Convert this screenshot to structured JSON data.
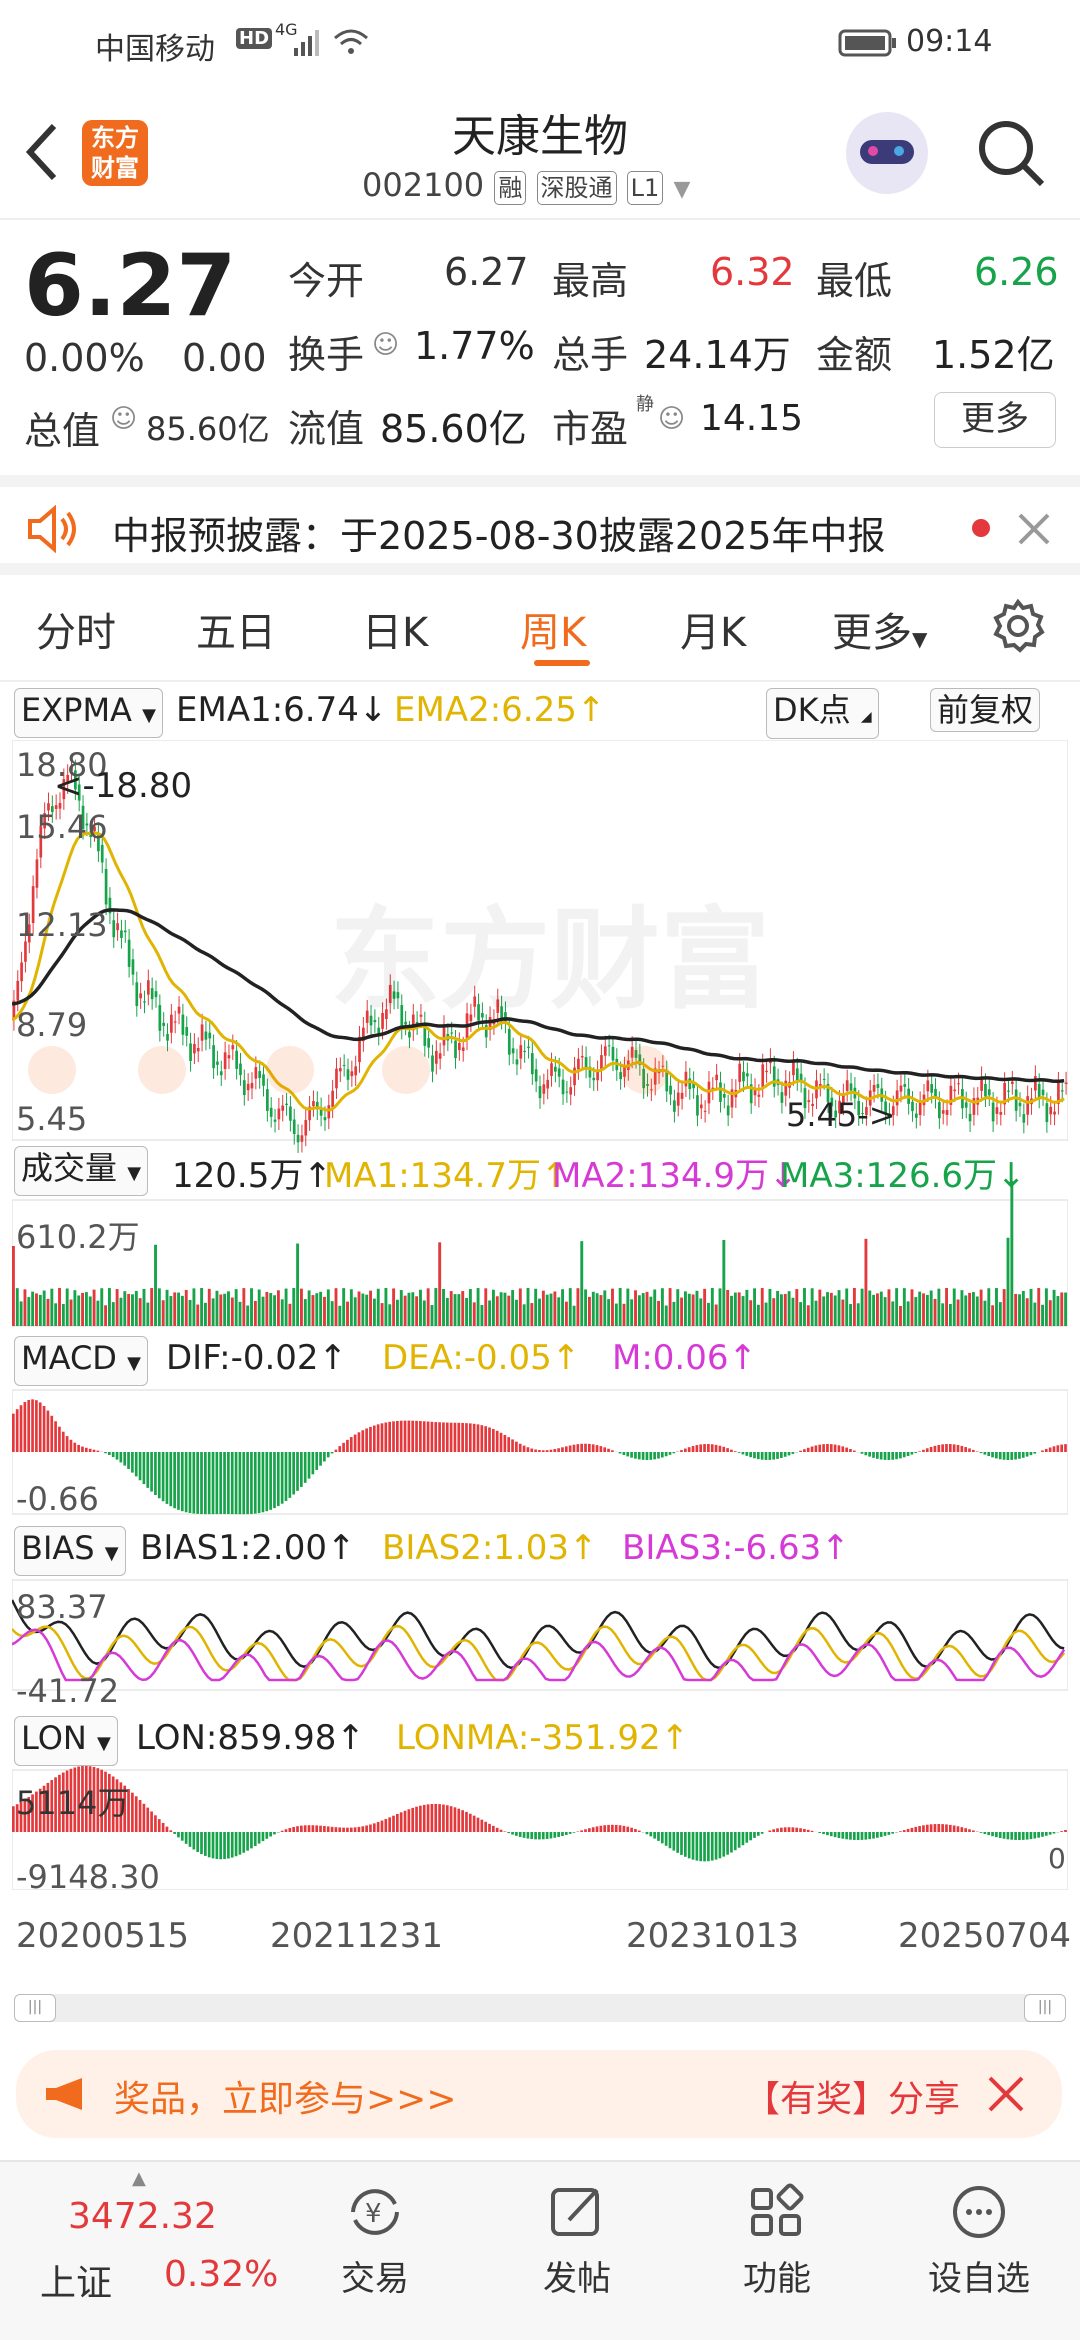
{
  "status_bar": {
    "carrier": "中国移动",
    "hd": "HD",
    "net": "4G",
    "time": "09:14"
  },
  "header": {
    "logo_line1": "东方",
    "logo_line2": "财富",
    "title": "天康生物",
    "code": "002100",
    "tag1": "融",
    "tag2": "深股通",
    "tag3": "L1"
  },
  "quote": {
    "price": "6.27",
    "change_pct": "0.00%",
    "change": "0.00",
    "open_label": "今开",
    "open": "6.27",
    "high_label": "最高",
    "high": "6.32",
    "low_label": "最低",
    "low": "6.26",
    "turnover_label": "换手",
    "turnover": "1.77%",
    "volume_label": "总手",
    "volume": "24.14万",
    "amount_label": "金额",
    "amount": "1.52亿",
    "mktcap_label": "总值",
    "mktcap": "85.60亿",
    "float_label": "流值",
    "float": "85.60亿",
    "pe_label": "市盈",
    "pe_sup": "静",
    "pe": "14.15",
    "more_label": "更多"
  },
  "notice": {
    "text": "中报预披露：于2025-08-30披露2025年中报"
  },
  "tabs": [
    "分时",
    "五日",
    "日K",
    "周K",
    "月K",
    "更多"
  ],
  "active_tab": "周K",
  "kline": {
    "indicator": "EXPMA",
    "ema1": "EMA1:6.74",
    "ema2": "EMA2:6.25",
    "dk_label": "DK点",
    "fq_label": "前复权",
    "y_labels": [
      "18.80",
      "15.46",
      "12.13",
      "8.79",
      "5.45"
    ],
    "max_marker": "<-18.80",
    "min_marker": "5.45->",
    "watermark": "东方财富"
  },
  "volume": {
    "label": "成交量",
    "value": "120.5万",
    "ma1": "MA1:134.7万",
    "ma2": "MA2:134.9万",
    "ma3": "MA3:126.6万",
    "top": "610.2万"
  },
  "macd": {
    "label": "MACD",
    "dif": "DIF:-0.02",
    "dea": "DEA:-0.05",
    "m": "M:0.06",
    "bottom": "-0.66"
  },
  "bias": {
    "label": "BIAS",
    "b1": "BIAS1:2.00",
    "b2": "BIAS2:1.03",
    "b3": "BIAS3:-6.63",
    "top": "83.37",
    "bottom": "-41.72"
  },
  "lon": {
    "label": "LON",
    "lon": "LON:859.98",
    "lonma": "LONMA:-351.92",
    "top": "5114万",
    "bottom": "-9148.30",
    "right": "0"
  },
  "dates": [
    "20200515",
    "20211231",
    "20231013",
    "20250704"
  ],
  "banner": {
    "left": "奖品，立即参与>>>",
    "right": "【有奖】分享"
  },
  "bottom": {
    "index_value": "3472.32",
    "index_name": "上证",
    "index_change": "0.32%",
    "items": [
      "交易",
      "发帖",
      "功能",
      "设自选"
    ]
  },
  "colors": {
    "accent": "#f06b1d",
    "up": "#e4393c",
    "down": "#16a34a",
    "ema2": "#e0b400"
  }
}
